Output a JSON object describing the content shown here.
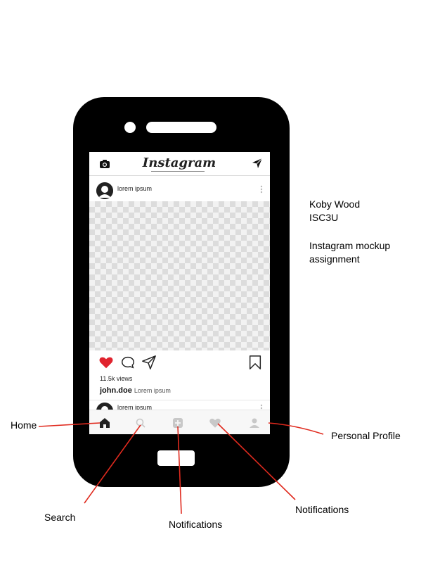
{
  "app": {
    "logo_text": "Instagram"
  },
  "post": {
    "username": "lorem ipsum",
    "views": "11.5k views",
    "caption_user": "john.doe",
    "caption_text": "Lorem ipsum",
    "liked": true
  },
  "next_post": {
    "username": "lorem ipsum"
  },
  "tabbar": {
    "tabs": [
      {
        "name": "home",
        "icon": "home-icon",
        "active": true
      },
      {
        "name": "search",
        "icon": "search-icon",
        "active": false
      },
      {
        "name": "new-post",
        "icon": "add-post-icon",
        "active": false
      },
      {
        "name": "activity",
        "icon": "heart-icon",
        "active": false
      },
      {
        "name": "profile",
        "icon": "profile-icon",
        "active": false
      }
    ]
  },
  "side_notes": {
    "line1": "Koby Wood",
    "line2": "ISC3U",
    "line3": "Instagram mockup",
    "line4": "assignment"
  },
  "annotations": {
    "home": "Home",
    "search": "Search",
    "notifications_1": "Notifications",
    "notifications_2": "Notifications",
    "personal_profile": "Personal Profile"
  },
  "colors": {
    "like_red": "#e0232e",
    "annotation_line": "#e02a1e",
    "phone_body": "#000000"
  }
}
